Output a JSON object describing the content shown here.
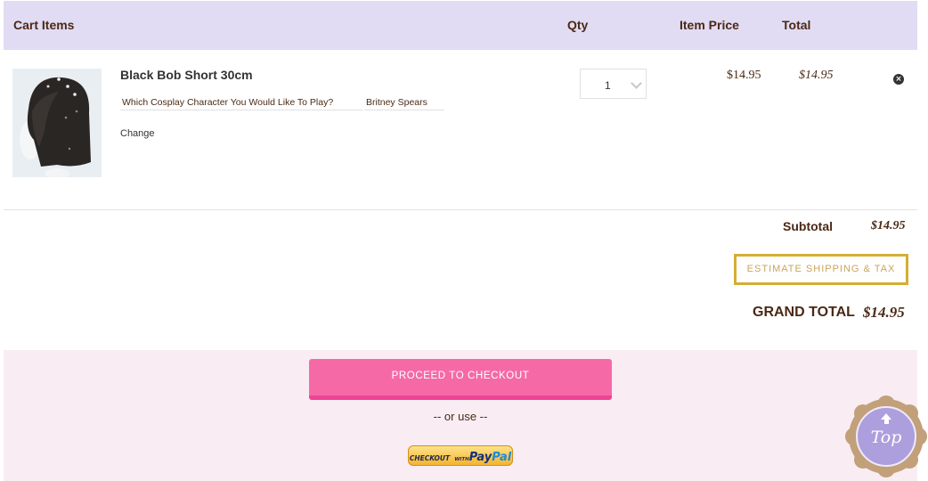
{
  "header": {
    "cart_items": "Cart Items",
    "qty": "Qty",
    "item_price": "Item Price",
    "total": "Total"
  },
  "cart": {
    "items": [
      {
        "name": "Black Bob Short 30cm",
        "image": "product-thumbnail-black-bob-wig",
        "option_question": "Which Cosplay Character You Would Like To Play?",
        "option_answer": "Britney Spears",
        "change_label": "Change",
        "qty": "1",
        "item_price": "$14.95",
        "total": "$14.95",
        "remove_icon": "close-circle-icon"
      }
    ]
  },
  "summary": {
    "subtotal_label": "Subtotal",
    "subtotal_value": "$14.95",
    "estimate_label": "ESTIMATE SHIPPING & TAX",
    "grand_total_label": "GRAND TOTAL",
    "grand_total_value": "$14.95"
  },
  "checkout": {
    "proceed_label": "PROCEED TO CHECKOUT",
    "or_use": "-- or use --",
    "paypal": {
      "prefix": "CHECKOUT",
      "with": "WITH",
      "brand_a": "Pay",
      "brand_b": "Pal"
    }
  },
  "back_to_top": {
    "label": "Top",
    "icon": "arrow-up-icon"
  },
  "colors": {
    "header_bg": "#e1dcf3",
    "text_brown": "#4b2815",
    "estimate_border": "#d4ae35",
    "checkout_pink": "#f56aa6",
    "checkout_panel_bg": "#f9ecf3",
    "top_button_purple": "#ad9fdd",
    "top_button_frame": "#c1a07a"
  }
}
